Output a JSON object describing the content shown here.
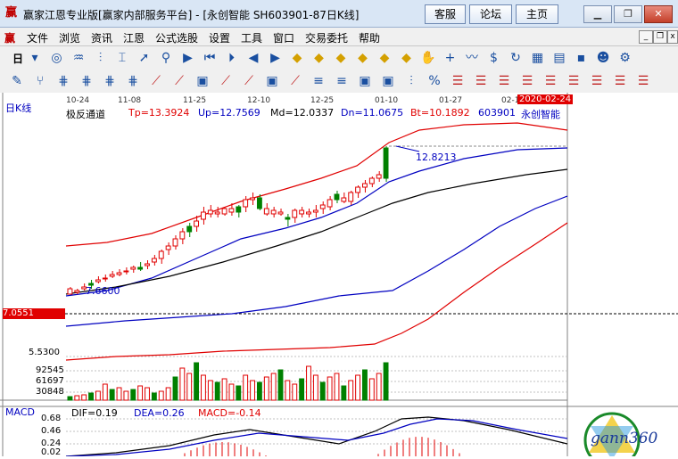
{
  "window": {
    "app_icon": "赢",
    "title": "赢家江恩专业版[赢家内部服务平台] - [永创智能  SH603901-87日K线]",
    "buttons": [
      "客服",
      "论坛",
      "主页"
    ],
    "controls": [
      "minimize-icon",
      "restore-icon",
      "close-icon"
    ]
  },
  "menu": {
    "items": [
      "文件",
      "浏览",
      "资讯",
      "江恩",
      "公式选股",
      "设置",
      "工具",
      "窗口",
      "交易委托",
      "帮助"
    ]
  },
  "toolbar1": {
    "first_label": "日",
    "icons": [
      "dropdown-icon",
      "stock-icon",
      "kline-icon",
      "bars-icon",
      "candle-icon",
      "arrow-icon",
      "zoom-icon",
      "flag-icon",
      "first-icon",
      "play-icon",
      "prev-icon",
      "next-icon",
      "diamond-icon",
      "diamond-icon",
      "diamond-icon",
      "diamond-icon",
      "diamond-icon",
      "diamond-icon",
      "hand-icon",
      "crosshair-icon",
      "wave-icon",
      "money-icon",
      "refresh-icon",
      "calendar-icon",
      "grid-icon",
      "save-icon",
      "people-icon",
      "settings-icon"
    ]
  },
  "toolbar2": {
    "icons": [
      "pencil-icon",
      "fork-icon",
      "gann-icon",
      "gann-icon",
      "gann-icon",
      "gann-icon",
      "fan-icon",
      "fan-icon",
      "box-icon",
      "fan-icon",
      "fan-icon",
      "box-icon",
      "fan-icon",
      "lines-icon",
      "lines-icon",
      "box-icon",
      "box-icon",
      "bars-icon",
      "percent-icon",
      "fib-icon",
      "fib-icon",
      "fib-icon",
      "fib-icon",
      "fib-icon",
      "fib-icon",
      "fib-icon",
      "fib-icon",
      "fib-icon"
    ]
  },
  "chart": {
    "period_label": "日K线",
    "indicator_name": "极反通道",
    "tp": "Tp=13.3924",
    "up": "Up=12.7569",
    "md": "Md=12.0337",
    "dn": "Dn=11.0675",
    "bt": "Bt=10.1892",
    "stock_code": "603901",
    "stock_name": "永创智能",
    "date_ticks": [
      "10-24",
      "11-08",
      "11-25",
      "12-10",
      "12-25",
      "01-10",
      "01-27",
      "02-1"
    ],
    "cursor_date": "2020-02-24",
    "price_label_high": "12.8213",
    "price_label_low": "7.6600",
    "left_axis_value": "7.0551",
    "volume_axis": [
      "5.5300",
      "92545",
      "61697",
      "30848"
    ],
    "macd_label": "MACD",
    "dif": "DIF=0.19",
    "dea": "DEA=0.26",
    "macd": "MACD=-0.14",
    "macd_axis": [
      "0.68",
      "0.46",
      "0.24",
      "0.02"
    ],
    "logo_text": "gann360",
    "colors": {
      "up": "#e00000",
      "down": "#008000",
      "channel_red": "#e00000",
      "channel_blue": "#0000c0",
      "channel_black": "#000000"
    }
  }
}
